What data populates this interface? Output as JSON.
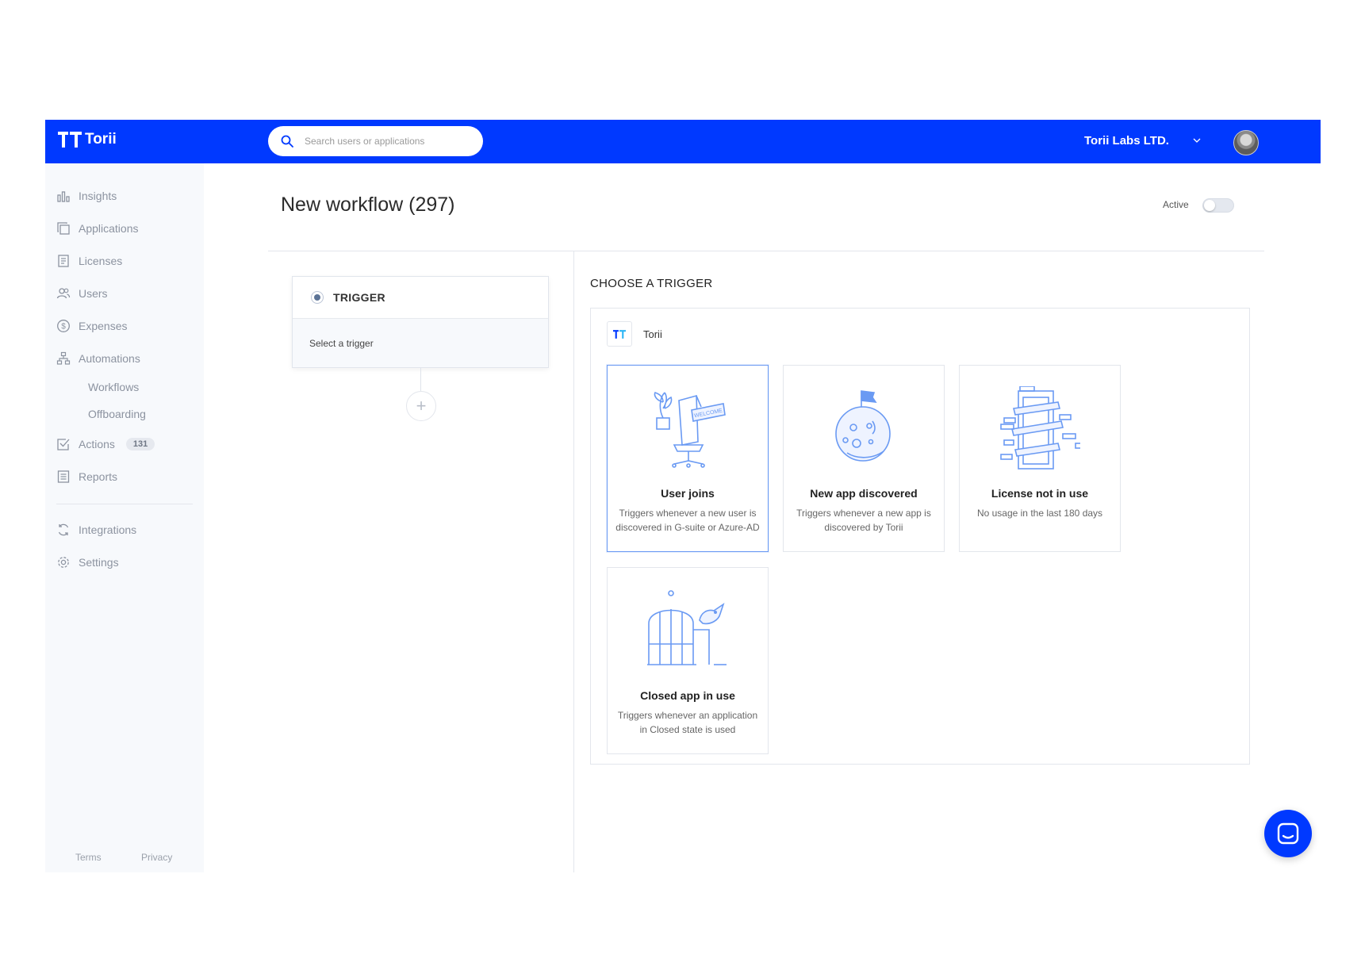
{
  "brand": {
    "name": "Torii",
    "primary_color": "#0039ff",
    "accent_color": "#6a9af3"
  },
  "header": {
    "search_placeholder": "Search users or applications",
    "org_name": "Torii Labs LTD."
  },
  "sidebar": {
    "items": [
      {
        "label": "Insights",
        "icon": "bar-chart-icon"
      },
      {
        "label": "Applications",
        "icon": "copy-icon"
      },
      {
        "label": "Licenses",
        "icon": "document-icon"
      },
      {
        "label": "Users",
        "icon": "users-icon"
      },
      {
        "label": "Expenses",
        "icon": "dollar-icon"
      },
      {
        "label": "Automations",
        "icon": "hierarchy-icon"
      },
      {
        "label": "Actions",
        "icon": "checkbox-icon",
        "badge": "131"
      },
      {
        "label": "Reports",
        "icon": "report-icon"
      },
      {
        "label": "Integrations",
        "icon": "sync-icon"
      },
      {
        "label": "Settings",
        "icon": "gear-icon"
      }
    ],
    "subitems": [
      "Workflows",
      "Offboarding"
    ],
    "footer": {
      "terms": "Terms",
      "privacy": "Privacy"
    }
  },
  "page": {
    "title": "New workflow (297)",
    "active_label": "Active",
    "active": false
  },
  "trigger_step": {
    "title": "TRIGGER",
    "placeholder": "Select a trigger",
    "add_symbol": "+"
  },
  "chooser": {
    "title": "CHOOSE A TRIGGER",
    "provider": "Torii",
    "cards": [
      {
        "title": "User joins",
        "description": "Triggers whenever a new user is discovered in G-suite or Azure-AD",
        "selected": true
      },
      {
        "title": "New app discovered",
        "description": "Triggers whenever a new app is discovered by Torii",
        "selected": false
      },
      {
        "title": "License not in use",
        "description": "No usage in the last 180 days",
        "selected": false
      },
      {
        "title": "Closed app in use",
        "description": "Triggers whenever an application in Closed state is used",
        "selected": false
      }
    ]
  }
}
